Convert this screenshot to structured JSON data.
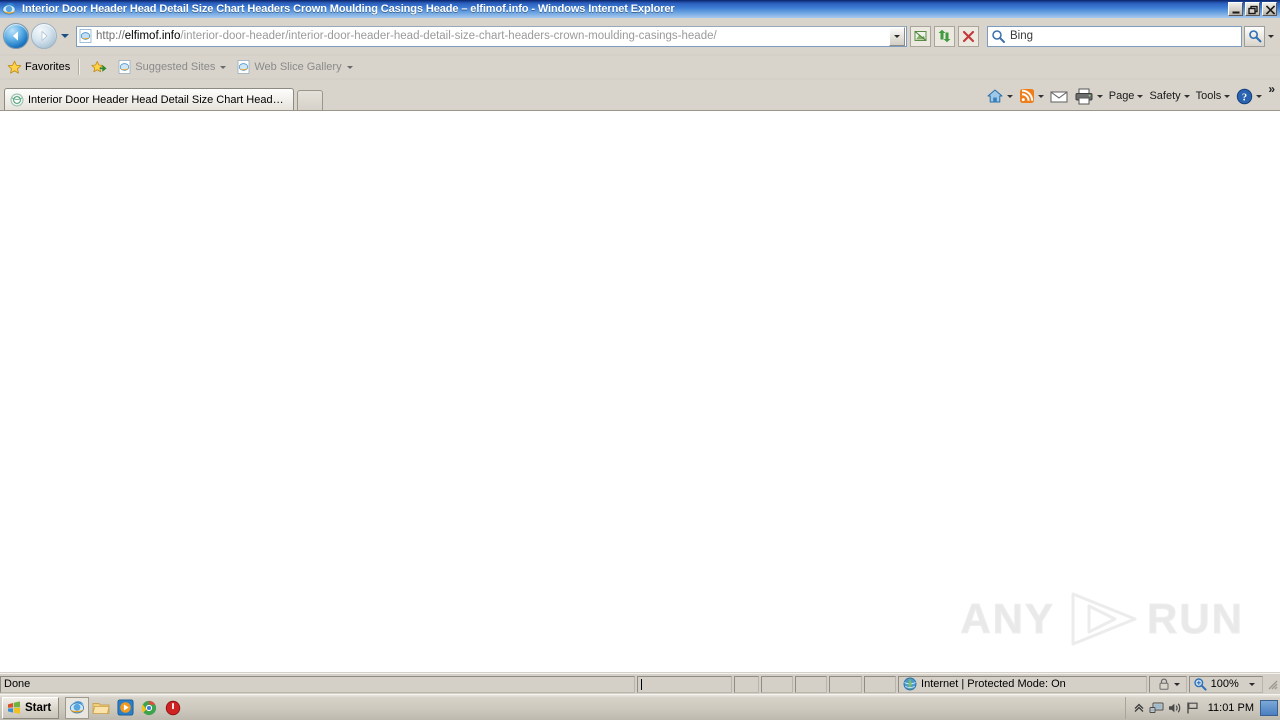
{
  "window": {
    "title": "Interior Door Header Head Detail Size Chart Headers Crown Moulding Casings Heade – elfimof.info - Windows Internet Explorer",
    "minimize_label": "Minimize",
    "restore_label": "Restore",
    "close_label": "Close"
  },
  "navigation": {
    "back_label": "Back",
    "forward_label": "Forward",
    "recent_pages_label": "Recent Pages"
  },
  "address": {
    "protocol": "http://",
    "host": "elfimof.info",
    "path": "/interior-door-header/interior-door-header-head-detail-size-chart-headers-crown-moulding-casings-heade/",
    "full_url": "http://elfimof.info/interior-door-header/interior-door-header-head-detail-size-chart-headers-crown-moulding-casings-heade/",
    "dropdown_label": "Address dropdown",
    "compatibility_label": "Compatibility View",
    "refresh_label": "Refresh",
    "stop_label": "Stop"
  },
  "search": {
    "provider": "Bing",
    "placeholder": "Bing",
    "go_label": "Search",
    "dropdown_label": "Search options"
  },
  "favorites_bar": {
    "favorites_label": "Favorites",
    "items": [
      {
        "label": "Suggested Sites",
        "has_caret": true
      },
      {
        "label": "Web Slice Gallery",
        "has_caret": true
      }
    ]
  },
  "tabs": [
    {
      "title": "Interior Door Header Head Detail Size Chart Headers ...",
      "active": true
    }
  ],
  "new_tab_label": "New Tab",
  "command_bar": {
    "items": [
      {
        "name": "home",
        "label": "",
        "icon": "home-icon",
        "caret": true
      },
      {
        "name": "feeds",
        "label": "",
        "icon": "rss-icon",
        "caret": true
      },
      {
        "name": "read-mail",
        "label": "",
        "icon": "mail-icon",
        "caret": false
      },
      {
        "name": "print",
        "label": "",
        "icon": "printer-icon",
        "caret": true
      },
      {
        "name": "page",
        "label": "Page",
        "icon": "",
        "caret": true
      },
      {
        "name": "safety",
        "label": "Safety",
        "icon": "",
        "caret": true
      },
      {
        "name": "tools",
        "label": "Tools",
        "icon": "",
        "caret": true
      },
      {
        "name": "help",
        "label": "",
        "icon": "help-icon",
        "caret": true
      }
    ],
    "overflow_label": "»"
  },
  "page": {
    "body_text": "",
    "watermark": {
      "left": "ANY",
      "right": "RUN"
    }
  },
  "status_bar": {
    "status": "Done",
    "progress": "",
    "zone": "Internet | Protected Mode: On",
    "zoom": "100%",
    "privacy_label": "Privacy Report",
    "zoom_dropdown_label": "Change Zoom Level"
  },
  "taskbar": {
    "start_label": "Start",
    "quick_launch": [
      {
        "name": "internet-explorer",
        "active": true
      },
      {
        "name": "file-explorer",
        "active": false
      },
      {
        "name": "media-player",
        "active": false
      },
      {
        "name": "chrome",
        "active": false
      },
      {
        "name": "shutdown-app",
        "active": false
      }
    ],
    "tray": [
      {
        "name": "show-hidden-icons"
      },
      {
        "name": "network-icon"
      },
      {
        "name": "volume-icon"
      },
      {
        "name": "flag-icon"
      }
    ],
    "clock": "11:01 PM",
    "show_desktop_label": "Show desktop"
  },
  "colors": {
    "title_bar_start": "#0a246a",
    "title_bar_end": "#a8c9ee",
    "chrome_bg": "#d8d4cc",
    "content_bg": "#ffffff",
    "accent_blue": "#1a74c0"
  }
}
